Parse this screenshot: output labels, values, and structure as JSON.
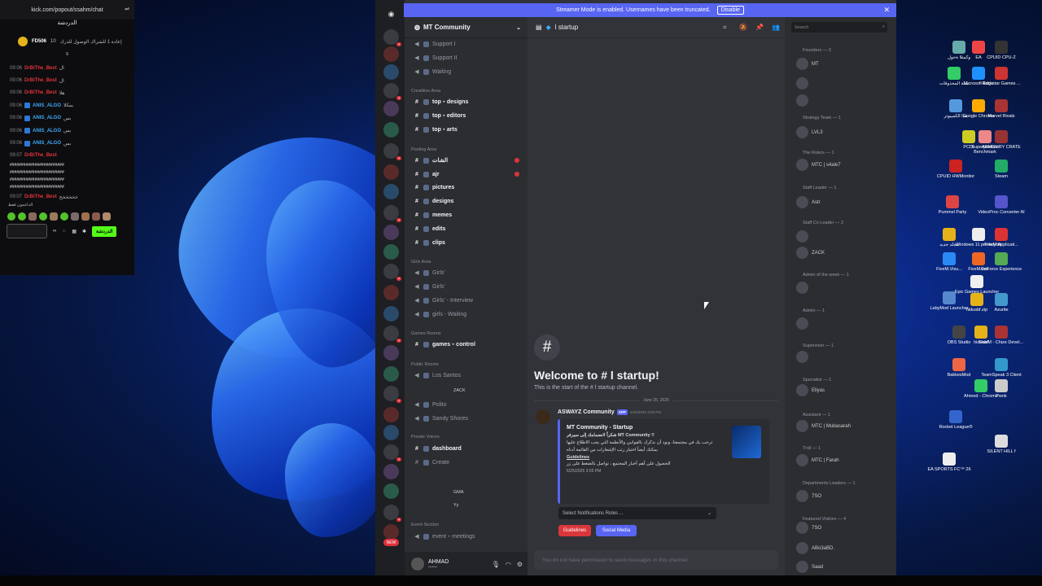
{
  "chat": {
    "url": "kick.com/popout/ssahm/chat",
    "header": "الدردشة",
    "pinned_user": "FD506",
    "pinned_count": "10",
    "pinned_text": "إعادة 1 للشراك الوصول للدرك",
    "messages": [
      {
        "time": "09:06",
        "user": "DrBiThe_Best",
        "text": "ال"
      },
      {
        "time": "09:06",
        "user": "DrBiThe_Best",
        "text": "ال"
      },
      {
        "time": "09:06",
        "user": "DrBiThe_Best",
        "text": "هلا"
      },
      {
        "time": "09:06",
        "user": "ANIS_ALGO",
        "text": "يمكلا"
      },
      {
        "time": "09:06",
        "user": "ANIS_ALGO",
        "text": "بس"
      },
      {
        "time": "09:06",
        "user": "ANIS_ALGO",
        "text": "بس"
      },
      {
        "time": "09:06",
        "user": "ANIS_ALGO",
        "text": "بس"
      },
      {
        "time": "09:07",
        "user": "DrBiThe_Best",
        "text": ""
      },
      {
        "time": "09:07",
        "user": "DrBiThe_Best",
        "text": "خخخخخخ"
      }
    ],
    "spam_line": "########################",
    "supporters_label": "الداعمون فقط",
    "send_label": "الدردشة"
  },
  "discord": {
    "banner": "Streamer Mode is enabled. Usernames have been truncated.",
    "banner_button": "Disable",
    "server_name": "MT Community",
    "channel_title": "startup",
    "search_placeholder": "Search",
    "categories": {
      "creative": "Creatitive Area",
      "posting": "Posting Area",
      "girls": "Girls Area",
      "games": "Games Rooms",
      "public": "Public Rooms",
      "private": "Private Voices",
      "event": "Event Section"
    },
    "channels": [
      {
        "name": "Support I",
        "bright": false
      },
      {
        "name": "Support II",
        "bright": false
      },
      {
        "name": "Waiting",
        "bright": false
      },
      {
        "name": "top・designs",
        "bright": true
      },
      {
        "name": "top・editors",
        "bright": true
      },
      {
        "name": "top・arts",
        "bright": true
      },
      {
        "name": "الشات",
        "bright": true
      },
      {
        "name": "ajr",
        "bright": true
      },
      {
        "name": "pictures",
        "bright": true
      },
      {
        "name": "designs",
        "bright": true
      },
      {
        "name": "memes",
        "bright": true
      },
      {
        "name": "edits",
        "bright": true
      },
      {
        "name": "clips",
        "bright": true
      },
      {
        "name": "Girls'",
        "bright": false
      },
      {
        "name": "Girls'",
        "bright": false
      },
      {
        "name": "Girls' - Interview",
        "bright": false
      },
      {
        "name": "girls - Waiting",
        "bright": false
      },
      {
        "name": "games・control",
        "bright": true
      },
      {
        "name": "Los Santos",
        "bright": false
      },
      {
        "name": "Polito",
        "bright": false
      },
      {
        "name": "Sandy Shores",
        "bright": false
      },
      {
        "name": "dashboard",
        "bright": true
      },
      {
        "name": "Create",
        "bright": false
      },
      {
        "name": "event・meetings",
        "bright": false
      }
    ],
    "subusers": [
      "ZACK",
      "GMA",
      "Yy"
    ],
    "user_name": "AHMAD",
    "welcome_title": "Welcome to #  l startup!",
    "welcome_sub": "This is the start of the #  l startup channel.",
    "date_sep": "June 25, 2025",
    "post_author": "ASWAYZ Community",
    "post_badge": "APP",
    "post_time": "6/25/2025 3:05 PM",
    "embed_title": "MT Community - Startup",
    "embed_lines": [
      "شكراً لانضمامك إلى سيرفر MT Community !!",
      "ترحب بك في مجتمعنا، ونود أن نذكرك بالقوانين والأنظمة التي يجب الاطلاع عليها",
      "يمكنك أيضاً اختيار رتب الإشعارات من القائمة أدناه",
      "Guidelines",
      "الحصول على أهم أخبار المجتمع ، تواصل بالضغط على زر",
      "6/25/2025 3:05 PM"
    ],
    "select_placeholder": "Select Notifications Roles ...",
    "btn_guidelines": "Guidelines",
    "btn_social": "Social Media",
    "input_placeholder": "You do not have permission to send messages in this channel.",
    "roles": [
      "Founders — 3",
      "Strategy Team — 1",
      "The Rulers — 1",
      "Staff Leader — 1",
      "Staff Co Leader — 2",
      "Admin of the week — 1",
      "Admin — 1",
      "Supervisor — 1",
      "Specialist — 1",
      "Assistant — 1",
      "Troll — 1",
      "Departments Leaders — 1",
      "Featured Visitors — 4"
    ],
    "members": [
      "MT",
      "LVL3",
      "MTC | s4ale7",
      "GAZA",
      "Astr",
      "ZACK",
      "SYR",
      "DL",
      "Eliyas",
      "MTC | Mubasarah",
      "ASI",
      "MTC | Farah",
      "MT",
      "7SO",
      "ABo3aBD.",
      "Saad"
    ]
  },
  "desktop": [
    "وكمتلا ةحول",
    "EA",
    "CPUID CPU-Z",
    "سلة المحذوفات",
    "Microsoft Edge",
    "Rockstar Games ...",
    "هذا الكمبيوتر",
    "Google Chrome",
    "Marvel Rivals",
    "PCDI",
    "Superposition Benchmark",
    "ARMOURY CRATE",
    "CPUID HWMonitor",
    "Steam",
    "Pummel Party",
    "VideoProc Converter AI",
    "مجلد جديد",
    "Windows 11 pro key.txt",
    "FiveM Applicati...",
    "FiveM.Visu...",
    "FiveM.exe",
    "GeForce Experience",
    "Epic Games Launcher",
    "LabyMod Launcher",
    "hidusbf.zip",
    "Azurite",
    "OBS Studio",
    "hidusbf",
    "FiveM - Chize Devel...",
    "BakkesMod",
    "TeamSpeak 3 Client",
    "Ahmed - Chrome",
    "Pwnk",
    "Rocket League®",
    "SILENT HILL f",
    "EA SPORTS FC™ 26"
  ]
}
